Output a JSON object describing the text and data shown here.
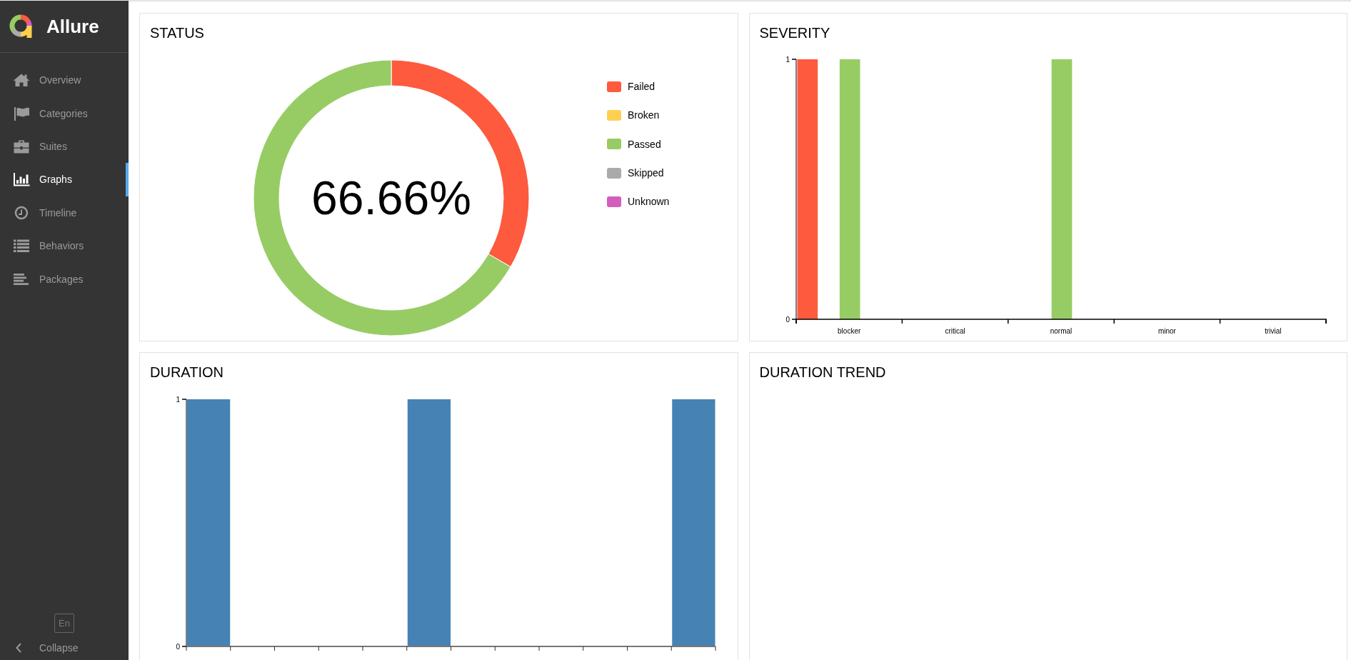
{
  "sidebar": {
    "title": "Allure",
    "items": [
      {
        "label": "Overview",
        "selected": false
      },
      {
        "label": "Categories",
        "selected": false
      },
      {
        "label": "Suites",
        "selected": false
      },
      {
        "label": "Graphs",
        "selected": true
      },
      {
        "label": "Timeline",
        "selected": false
      },
      {
        "label": "Behaviors",
        "selected": false
      },
      {
        "label": "Packages",
        "selected": false
      }
    ],
    "language": "En",
    "collapse": "Collapse"
  },
  "status": {
    "title": "STATUS",
    "center_label": "66.66%",
    "chart_data": {
      "type": "donut",
      "categories": [
        "Failed",
        "Broken",
        "Passed",
        "Skipped",
        "Unknown"
      ],
      "values": [
        33.34,
        0,
        66.66,
        0,
        0
      ]
    },
    "legend": [
      {
        "color": "#fd5a3e"
      },
      {
        "color": "#ffd050"
      },
      {
        "color": "#97cc64"
      },
      {
        "color": "#aaaaaa"
      },
      {
        "color": "#d35ebe"
      }
    ]
  },
  "severity": {
    "title": "SEVERITY",
    "chart_data": {
      "type": "bar",
      "categories": [
        "blocker",
        "critical",
        "normal",
        "minor",
        "trivial"
      ],
      "series": [
        {
          "color": "#fd5a3e",
          "values": [
            1,
            0,
            0,
            0,
            0
          ]
        },
        {
          "values": [
            0,
            0,
            0,
            0,
            0
          ]
        },
        {
          "color": "#97cc64",
          "values": [
            1,
            0,
            1,
            0,
            0
          ]
        },
        {
          "values": [
            0,
            0,
            0,
            0,
            0
          ]
        },
        {
          "values": [
            0,
            0,
            0,
            0,
            0
          ]
        }
      ],
      "ylim": [
        0,
        1
      ],
      "yticks": [
        0,
        1
      ]
    }
  },
  "duration": {
    "title": "DURATION",
    "chart_data": {
      "type": "bar",
      "values": [
        1,
        0,
        0,
        0,
        0,
        1,
        0,
        0,
        0,
        0,
        0,
        1
      ],
      "ylim": [
        0,
        1
      ],
      "yticks": [
        0,
        1
      ]
    }
  },
  "duration_trend": {
    "title": "DURATION TREND"
  }
}
